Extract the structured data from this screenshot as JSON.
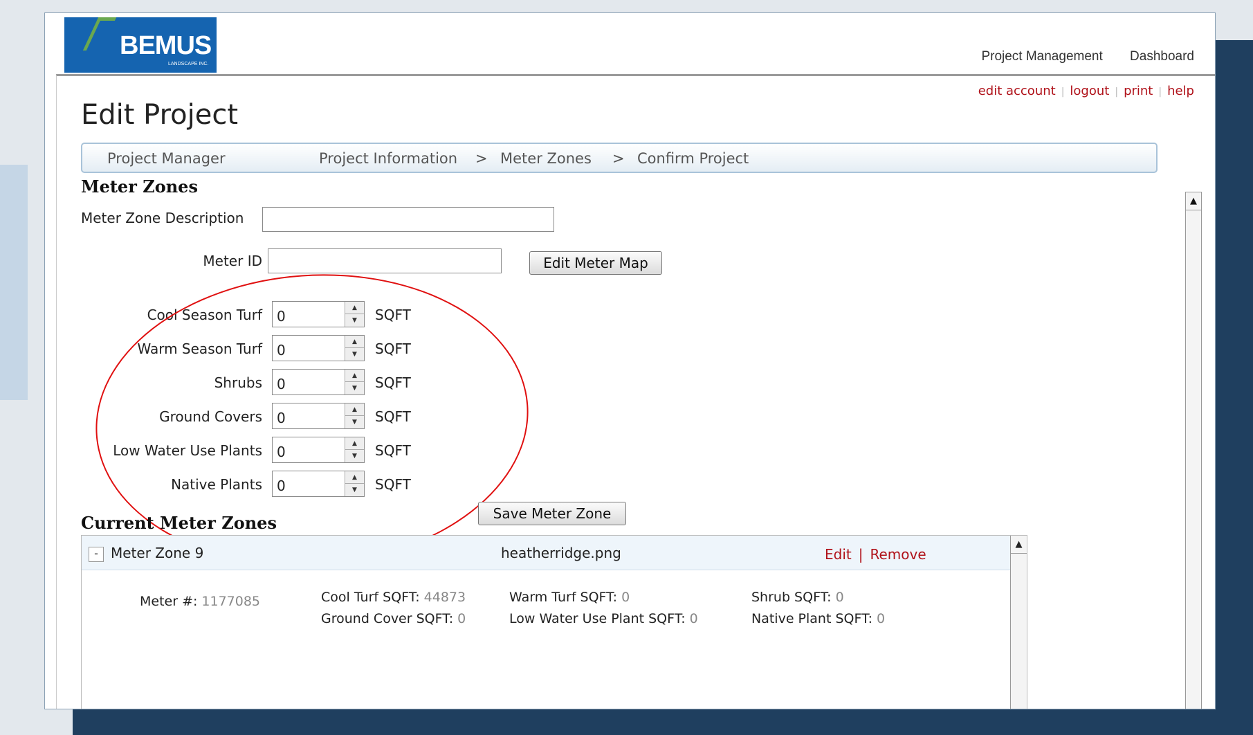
{
  "logo": {
    "name": "BEMUS",
    "sub": "LANDSCAPE INC."
  },
  "topnav": {
    "project_management": "Project Management",
    "dashboard": "Dashboard"
  },
  "account": {
    "edit_account": "edit account",
    "logout": "logout",
    "print": "print",
    "help": "help",
    "separator": "|"
  },
  "page": {
    "title": "Edit Project"
  },
  "breadcrumb": {
    "items": [
      "Project Manager",
      "Project Information",
      "Meter Zones",
      "Confirm Project"
    ],
    "separator": ">"
  },
  "form": {
    "section_title": "Meter Zones",
    "description_label": "Meter Zone Description",
    "description_value": "",
    "meter_id_label": "Meter ID",
    "meter_id_value": "",
    "edit_map_button": "Edit Meter Map",
    "unit": "SQFT",
    "fields": [
      {
        "label": "Cool Season Turf",
        "value": "0"
      },
      {
        "label": "Warm Season Turf",
        "value": "0"
      },
      {
        "label": "Shrubs",
        "value": "0"
      },
      {
        "label": "Ground Covers",
        "value": "0"
      },
      {
        "label": "Low Water Use Plants",
        "value": "0"
      },
      {
        "label": "Native Plants",
        "value": "0"
      }
    ],
    "save_button": "Save Meter Zone"
  },
  "current": {
    "section_title": "Current Meter Zones",
    "zone": {
      "toggle": "-",
      "name": "Meter Zone 9",
      "file": "heatherridge.png",
      "edit": "Edit",
      "separator": "|",
      "remove": "Remove",
      "meter_label": "Meter #:",
      "meter_value": "1177085",
      "details": [
        {
          "label": "Cool Turf SQFT:",
          "value": "44873"
        },
        {
          "label": "Warm Turf SQFT:",
          "value": "0"
        },
        {
          "label": "Shrub SQFT:",
          "value": "0"
        },
        {
          "label": "Ground Cover SQFT:",
          "value": "0"
        },
        {
          "label": "Low Water Use Plant SQFT:",
          "value": "0"
        },
        {
          "label": "Native Plant SQFT:",
          "value": "0"
        }
      ]
    }
  },
  "colors": {
    "accent_red": "#b0121a",
    "highlight_ellipse": "#e01010",
    "logo_blue": "#1564b0",
    "background_dark": "#1f3f5f"
  }
}
